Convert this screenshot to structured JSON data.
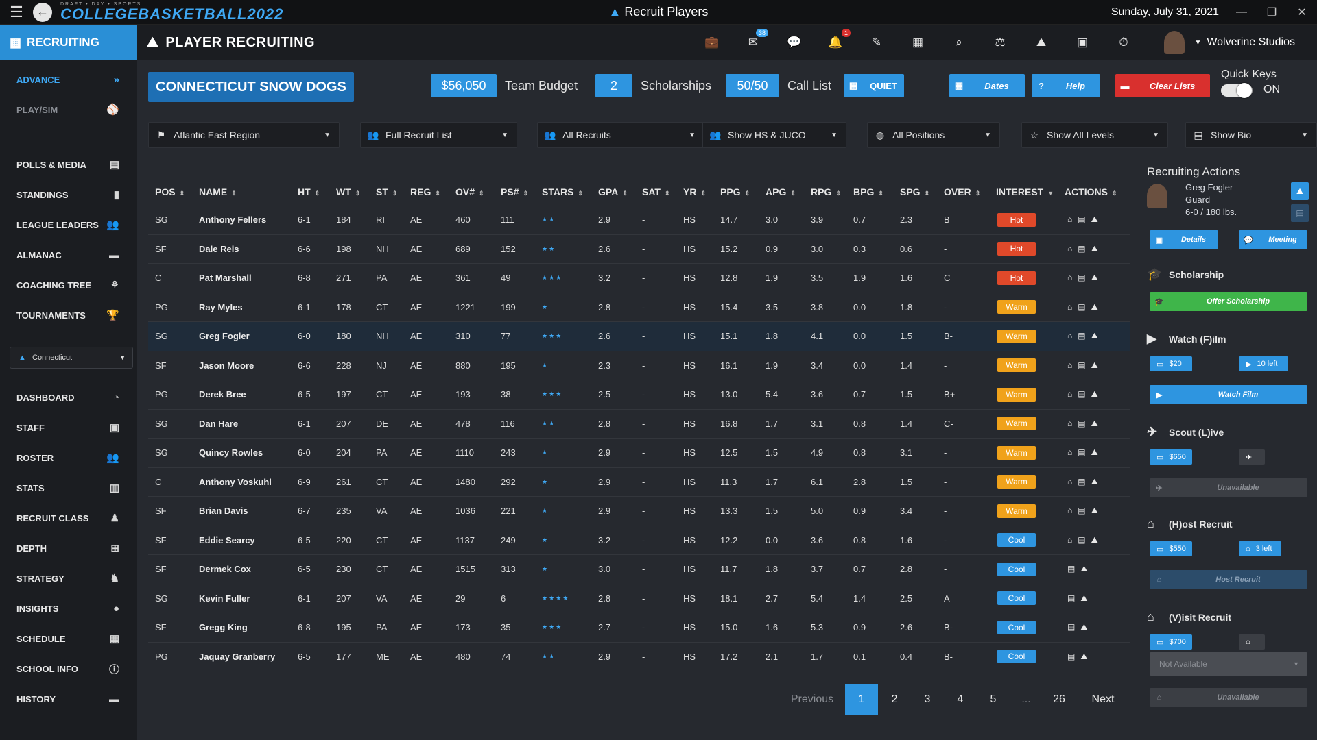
{
  "window": {
    "title": "Recruit Players",
    "date": "Sunday, July 31, 2021",
    "logo_small": "DRAFT • DAY • SPORTS",
    "logo": "COLLEGEBASKETBALL2022"
  },
  "nav": {
    "recruiting": "RECRUITING",
    "page_title": "PLAYER RECRUITING",
    "mail_badge": "38",
    "bell_badge": "1",
    "studio": "Wolverine Studios"
  },
  "sidebar": {
    "items": [
      {
        "label": "ADVANCE",
        "icon": "double-chevron-icon",
        "glyph": "»"
      },
      {
        "label": "PLAY/SIM",
        "icon": "ball-icon",
        "glyph": "⚾"
      },
      {
        "label": "POLLS & MEDIA",
        "icon": "media-icon",
        "glyph": "▤"
      },
      {
        "label": "STANDINGS",
        "icon": "bars-icon",
        "glyph": "▮"
      },
      {
        "label": "LEAGUE LEADERS",
        "icon": "users-icon",
        "glyph": "👥"
      },
      {
        "label": "ALMANAC",
        "icon": "archive-icon",
        "glyph": "▬"
      },
      {
        "label": "COACHING TREE",
        "icon": "tree-icon",
        "glyph": "⚘"
      },
      {
        "label": "TOURNAMENTS",
        "icon": "trophy-icon",
        "glyph": "🏆"
      },
      {
        "label": "DASHBOARD",
        "icon": "dashboard-icon",
        "glyph": "◔"
      },
      {
        "label": "STAFF",
        "icon": "clipboard-icon",
        "glyph": "▣"
      },
      {
        "label": "ROSTER",
        "icon": "group-icon",
        "glyph": "👥"
      },
      {
        "label": "STATS",
        "icon": "chart-icon",
        "glyph": "▥"
      },
      {
        "label": "RECRUIT CLASS",
        "icon": "recruit-icon",
        "glyph": "♟"
      },
      {
        "label": "DEPTH",
        "icon": "sitemap-icon",
        "glyph": "⊞"
      },
      {
        "label": "STRATEGY",
        "icon": "strategy-icon",
        "glyph": "♞"
      },
      {
        "label": "INSIGHTS",
        "icon": "bulb-icon",
        "glyph": "●"
      },
      {
        "label": "SCHEDULE",
        "icon": "calendar-icon",
        "glyph": "▦"
      },
      {
        "label": "SCHOOL INFO",
        "icon": "info-icon",
        "glyph": "ⓘ"
      },
      {
        "label": "HISTORY",
        "icon": "archive-icon",
        "glyph": "▬"
      }
    ],
    "team_select": "Connecticut"
  },
  "header": {
    "team_name": "CONNECTICUT SNOW DOGS",
    "budget_value": "$56,050",
    "budget_label": "Team Budget",
    "scholarships_value": "2",
    "scholarships_label": "Scholarships",
    "calllist_value": "50/50",
    "calllist_label": "Call List",
    "quiet_label": "QUIET",
    "dates_label": "Dates",
    "help_label": "Help",
    "clear_label": "Clear Lists",
    "quick_keys_label": "Quick Keys",
    "quick_keys_state": "ON"
  },
  "filters": [
    "Atlantic East Region",
    "Full Recruit List",
    "All Recruits",
    "Show HS & JUCO",
    "All Positions",
    "Show All Levels",
    "Show Bio"
  ],
  "table": {
    "columns": [
      "POS",
      "NAME",
      "HT",
      "WT",
      "ST",
      "REG",
      "OV#",
      "PS#",
      "STARS",
      "GPA",
      "SAT",
      "YR",
      "PPG",
      "APG",
      "RPG",
      "BPG",
      "SPG",
      "OVER",
      "INTEREST",
      "ACTIONS"
    ],
    "rows": [
      [
        "SG",
        "Anthony Fellers",
        "6-1",
        "184",
        "RI",
        "AE",
        "460",
        "111",
        "★★",
        "2.9",
        "-",
        "HS",
        "14.7",
        "3.0",
        "3.9",
        "0.7",
        "2.3",
        "B",
        "Hot"
      ],
      [
        "SF",
        "Dale Reis",
        "6-6",
        "198",
        "NH",
        "AE",
        "689",
        "152",
        "★★",
        "2.6",
        "-",
        "HS",
        "15.2",
        "0.9",
        "3.0",
        "0.3",
        "0.6",
        "-",
        "Hot"
      ],
      [
        "C",
        "Pat Marshall",
        "6-8",
        "271",
        "PA",
        "AE",
        "361",
        "49",
        "★★★",
        "3.2",
        "-",
        "HS",
        "12.8",
        "1.9",
        "3.5",
        "1.9",
        "1.6",
        "C",
        "Hot"
      ],
      [
        "PG",
        "Ray Myles",
        "6-1",
        "178",
        "CT",
        "AE",
        "1221",
        "199",
        "★",
        "2.8",
        "-",
        "HS",
        "15.4",
        "3.5",
        "3.8",
        "0.0",
        "1.8",
        "-",
        "Warm"
      ],
      [
        "SG",
        "Greg Fogler",
        "6-0",
        "180",
        "NH",
        "AE",
        "310",
        "77",
        "★★★",
        "2.6",
        "-",
        "HS",
        "15.1",
        "1.8",
        "4.1",
        "0.0",
        "1.5",
        "B-",
        "Warm"
      ],
      [
        "SF",
        "Jason Moore",
        "6-6",
        "228",
        "NJ",
        "AE",
        "880",
        "195",
        "★",
        "2.3",
        "-",
        "HS",
        "16.1",
        "1.9",
        "3.4",
        "0.0",
        "1.4",
        "-",
        "Warm"
      ],
      [
        "PG",
        "Derek Bree",
        "6-5",
        "197",
        "CT",
        "AE",
        "193",
        "38",
        "★★★",
        "2.5",
        "-",
        "HS",
        "13.0",
        "5.4",
        "3.6",
        "0.7",
        "1.5",
        "B+",
        "Warm"
      ],
      [
        "SG",
        "Dan Hare",
        "6-1",
        "207",
        "DE",
        "AE",
        "478",
        "116",
        "★★",
        "2.8",
        "-",
        "HS",
        "16.8",
        "1.7",
        "3.1",
        "0.8",
        "1.4",
        "C-",
        "Warm"
      ],
      [
        "SG",
        "Quincy Rowles",
        "6-0",
        "204",
        "PA",
        "AE",
        "1110",
        "243",
        "★",
        "2.9",
        "-",
        "HS",
        "12.5",
        "1.5",
        "4.9",
        "0.8",
        "3.1",
        "-",
        "Warm"
      ],
      [
        "C",
        "Anthony Voskuhl",
        "6-9",
        "261",
        "CT",
        "AE",
        "1480",
        "292",
        "★",
        "2.9",
        "-",
        "HS",
        "11.3",
        "1.7",
        "6.1",
        "2.8",
        "1.5",
        "-",
        "Warm"
      ],
      [
        "SF",
        "Brian Davis",
        "6-7",
        "235",
        "VA",
        "AE",
        "1036",
        "221",
        "★",
        "2.9",
        "-",
        "HS",
        "13.3",
        "1.5",
        "5.0",
        "0.9",
        "3.4",
        "-",
        "Warm"
      ],
      [
        "SF",
        "Eddie Searcy",
        "6-5",
        "220",
        "CT",
        "AE",
        "1137",
        "249",
        "★",
        "3.2",
        "-",
        "HS",
        "12.2",
        "0.0",
        "3.6",
        "0.8",
        "1.6",
        "-",
        "Cool"
      ],
      [
        "SF",
        "Dermek Cox",
        "6-5",
        "230",
        "CT",
        "AE",
        "1515",
        "313",
        "★",
        "3.0",
        "-",
        "HS",
        "11.7",
        "1.8",
        "3.7",
        "0.7",
        "2.8",
        "-",
        "Cool"
      ],
      [
        "SG",
        "Kevin Fuller",
        "6-1",
        "207",
        "VA",
        "AE",
        "29",
        "6",
        "★★★★",
        "2.8",
        "-",
        "HS",
        "18.1",
        "2.7",
        "5.4",
        "1.4",
        "2.5",
        "A",
        "Cool"
      ],
      [
        "SF",
        "Gregg King",
        "6-8",
        "195",
        "PA",
        "AE",
        "173",
        "35",
        "★★★",
        "2.7",
        "-",
        "HS",
        "15.0",
        "1.6",
        "5.3",
        "0.9",
        "2.6",
        "B-",
        "Cool"
      ],
      [
        "PG",
        "Jaquay Granberry",
        "6-5",
        "177",
        "ME",
        "AE",
        "480",
        "74",
        "★★",
        "2.9",
        "-",
        "HS",
        "17.2",
        "2.1",
        "1.7",
        "0.1",
        "0.4",
        "B-",
        "Cool"
      ]
    ]
  },
  "pager": {
    "prev": "Previous",
    "pages": [
      "1",
      "2",
      "3",
      "4",
      "5",
      "...",
      "26"
    ],
    "next": "Next"
  },
  "panel": {
    "title": "Recruiting Actions",
    "player_name": "Greg Fogler",
    "player_pos": "Guard",
    "player_size": "6-0 / 180 lbs.",
    "details": "Details",
    "meeting": "Meeting",
    "scholarship": "Scholarship",
    "offer": "Offer Scholarship",
    "watch": "Watch (F)ilm",
    "watch_cost": "$20",
    "watch_left": "10 left",
    "watch_btn": "Watch Film",
    "scout": "Scout (L)ive",
    "scout_cost": "$650",
    "unavailable": "Unavailable",
    "host": "(H)ost Recruit",
    "host_cost": "$550",
    "host_left": "3 left",
    "host_btn": "Host Recruit",
    "visit": "(V)isit Recruit",
    "visit_cost": "$700",
    "not_available": "Not Available",
    "unavailable2": "Unavailable"
  }
}
